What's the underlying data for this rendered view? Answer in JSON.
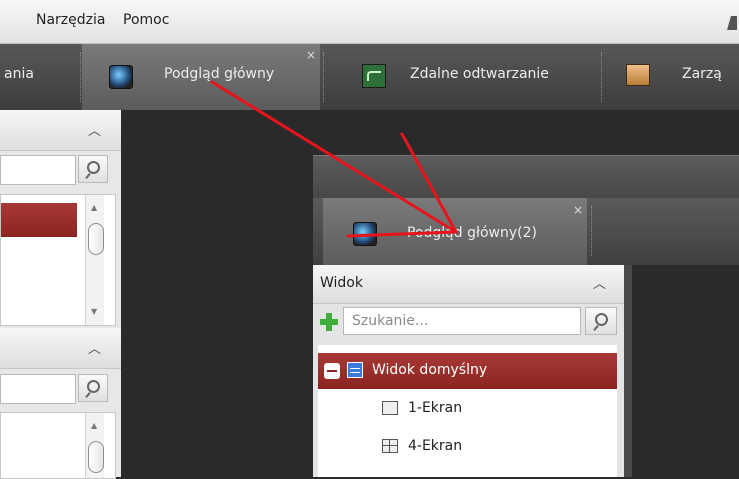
{
  "menu": {
    "items": [
      "Narzędzia",
      "Pomoc"
    ]
  },
  "tabs": {
    "partial_left": "ania",
    "main_view": "Podgląd główny",
    "remote_playback": "Zdalne odtwarzanie",
    "management_partial": "Zarzą"
  },
  "popup": {
    "tab_label": "Podgląd główny(2)",
    "section_title": "Widok",
    "search_placeholder": "Szukanie...",
    "tree": [
      {
        "label": "Widok domyślny",
        "selected": true
      },
      {
        "label": "1-Ekran",
        "selected": false
      },
      {
        "label": "4-Ekran",
        "selected": false
      }
    ]
  },
  "colors": {
    "accent_selected": "#9b2f2b",
    "annotation_arrow": "#e8141c"
  },
  "icons": [
    "monitor-icon",
    "playback-icon",
    "management-icon",
    "search-icon",
    "close-icon",
    "chevron-up-icon",
    "add-icon",
    "collapse-icon",
    "view-grid-icon",
    "single-screen-icon",
    "quad-screen-icon"
  ]
}
